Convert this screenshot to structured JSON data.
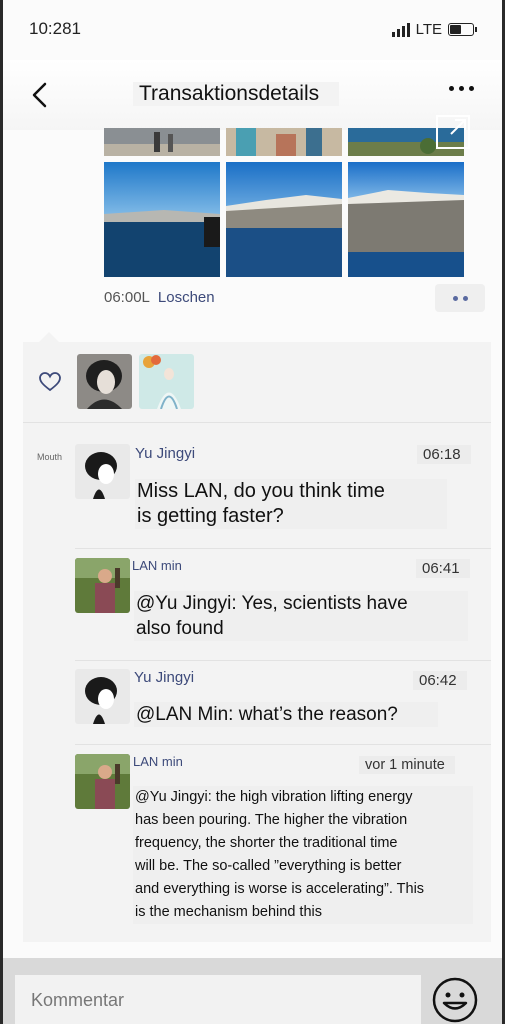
{
  "status": {
    "time": "10:281",
    "network": "LTE"
  },
  "nav": {
    "title": "Transaktionsdetails"
  },
  "post": {
    "time": "06:00L",
    "delete_label": "Loschen"
  },
  "comments": [
    {
      "label": "Mouth",
      "name": "Yu Jingyi",
      "time": "06:18",
      "text_lines": [
        "Miss LAN, do you think time",
        "is getting faster?"
      ]
    },
    {
      "name": "LAN min",
      "time": "06:41",
      "text_lines": [
        "@Yu Jingyi: Yes, scientists have",
        "also found"
      ]
    },
    {
      "name": "Yu Jingyi",
      "time": "06:42",
      "text_lines": [
        "@LAN Min: what’s the reason?"
      ]
    },
    {
      "name": "LAN min",
      "time": "vor 1 minute",
      "text_lines": [
        "@Yu Jingyi: the high vibration lifting energy",
        "has been pouring. The higher the vibration",
        "frequency, the shorter the traditional time",
        "will be. The so-called ”everything is better",
        "and everything is worse is accelerating”. This",
        "is the mechanism behind this"
      ]
    }
  ],
  "input": {
    "placeholder": "Kommentar"
  },
  "icons": [
    "signal-icon",
    "battery-icon",
    "back-icon",
    "more-icon",
    "expand-icon",
    "heart-icon",
    "emoji-icon"
  ],
  "colors": {
    "link": "#3d4a7a",
    "panel": "#f3f3f3",
    "dots": "#5a6aa0"
  }
}
